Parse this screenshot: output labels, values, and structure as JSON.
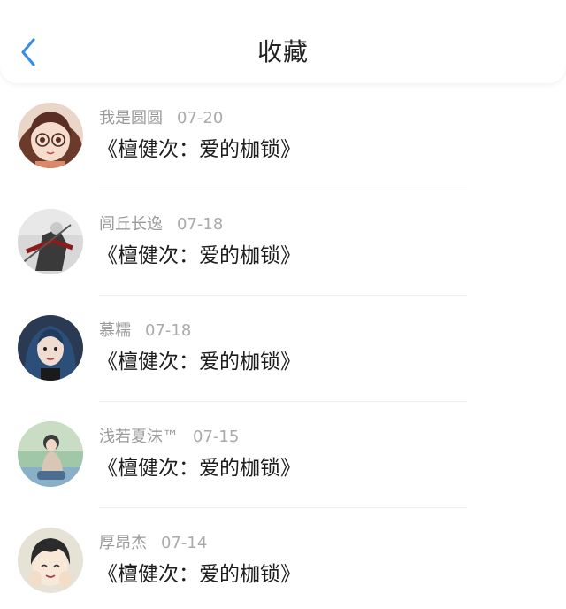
{
  "header": {
    "title": "收藏",
    "back_icon": "chevron-left-icon",
    "accent_color": "#3a8ee6"
  },
  "items": [
    {
      "user": "我是圆圆",
      "date": "07-20",
      "content": "《檀健次：爱的枷锁》",
      "avatar_icon": "cartoon-girl-avatar"
    },
    {
      "user": "闾丘长逸",
      "date": "07-18",
      "content": "《檀健次：爱的枷锁》",
      "avatar_icon": "warrior-avatar"
    },
    {
      "user": "慕糯",
      "date": "07-18",
      "content": "《檀健次：爱的枷锁》",
      "avatar_icon": "blue-hair-girl-avatar"
    },
    {
      "user": "浅若夏沫™",
      "date": "07-15",
      "content": "《檀健次：爱的枷锁》",
      "avatar_icon": "sitting-girl-avatar"
    },
    {
      "user": "厚昂杰",
      "date": "07-14",
      "content": "《檀健次：爱的枷锁》",
      "avatar_icon": "anime-boy-avatar"
    }
  ]
}
